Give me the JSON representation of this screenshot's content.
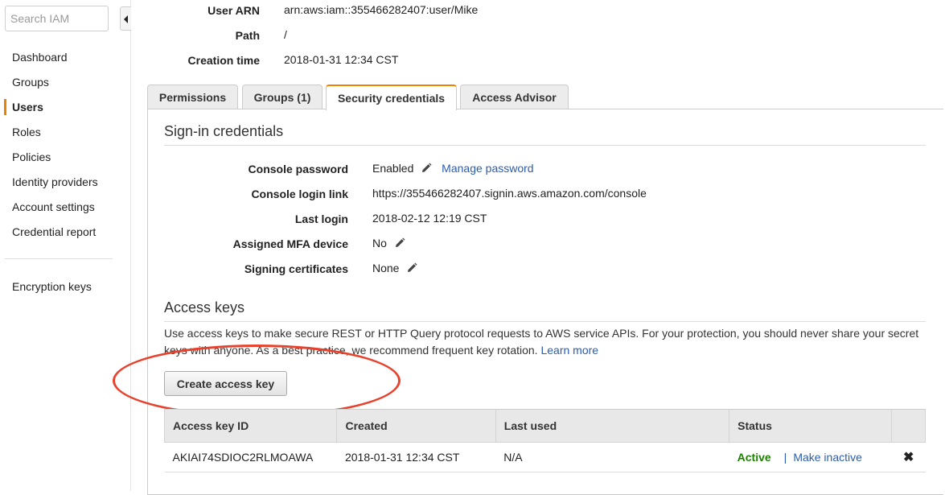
{
  "sidebar": {
    "search_placeholder": "Search IAM",
    "items": [
      {
        "label": "Dashboard"
      },
      {
        "label": "Groups"
      },
      {
        "label": "Users"
      },
      {
        "label": "Roles"
      },
      {
        "label": "Policies"
      },
      {
        "label": "Identity providers"
      },
      {
        "label": "Account settings"
      },
      {
        "label": "Credential report"
      }
    ],
    "extra_items": [
      {
        "label": "Encryption keys"
      }
    ],
    "active_item": "Users"
  },
  "summary": {
    "user_arn_label": "User ARN",
    "user_arn_value": "arn:aws:iam::355466282407:user/Mike",
    "path_label": "Path",
    "path_value": "/",
    "creation_time_label": "Creation time",
    "creation_time_value": "2018-01-31 12:34 CST"
  },
  "tabs": [
    {
      "label": "Permissions"
    },
    {
      "label": "Groups (1)"
    },
    {
      "label": "Security credentials"
    },
    {
      "label": "Access Advisor"
    }
  ],
  "active_tab": "Security credentials",
  "signin": {
    "title": "Sign-in credentials",
    "console_password_label": "Console password",
    "console_password_value": "Enabled",
    "manage_password_link": "Manage password",
    "console_login_link_label": "Console login link",
    "console_login_link_value": "https://355466282407.signin.aws.amazon.com/console",
    "last_login_label": "Last login",
    "last_login_value": "2018-02-12 12:19 CST",
    "mfa_label": "Assigned MFA device",
    "mfa_value": "No",
    "signing_certs_label": "Signing certificates",
    "signing_certs_value": "None"
  },
  "access_keys": {
    "title": "Access keys",
    "description": "Use access keys to make secure REST or HTTP Query protocol requests to AWS service APIs. For your protection, you should never share your secret keys with anyone. As a best practice, we recommend frequent key rotation.",
    "learn_more": "Learn more",
    "create_button": "Create access key",
    "columns": [
      "Access key ID",
      "Created",
      "Last used",
      "Status"
    ],
    "rows": [
      {
        "key_id": "AKIAI74SDIOC2RLMOAWA",
        "created": "2018-01-31 12:34 CST",
        "last_used": "N/A",
        "status": "Active",
        "action": "Make inactive"
      }
    ]
  },
  "colors": {
    "accent_tab": "#e98300",
    "link": "#2a5db0",
    "status_active": "#1d8102",
    "callout": "#e8412c"
  },
  "icons": [
    "collapse-arrow-icon",
    "pencil-icon",
    "delete-x-icon"
  ]
}
